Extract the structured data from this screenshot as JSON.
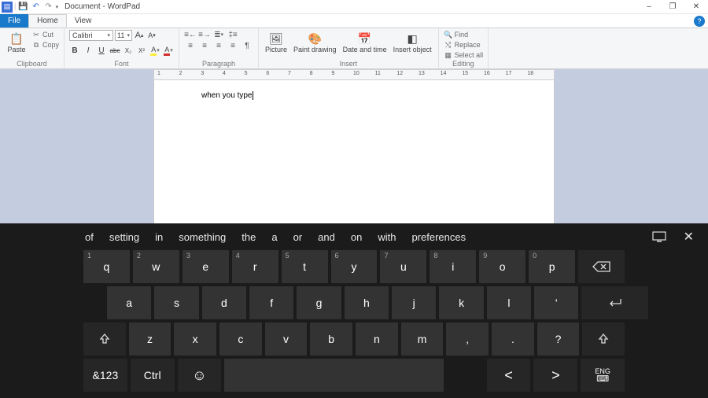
{
  "window": {
    "title": "Document - WordPad",
    "minimize": "–",
    "maximize": "❐",
    "close": "✕",
    "help": "?"
  },
  "qat": {
    "save": "💾",
    "undo": "↶",
    "redo": "↷"
  },
  "tabs": {
    "file": "File",
    "home": "Home",
    "view": "View"
  },
  "ribbon": {
    "clipboard": {
      "label": "Clipboard",
      "paste": "Paste",
      "cut": "Cut",
      "copy": "Copy"
    },
    "font": {
      "label": "Font",
      "name": "Calibri",
      "size": "11",
      "grow": "A",
      "shrink": "A",
      "bold": "B",
      "italic": "I",
      "underline": "U",
      "strike": "abc",
      "sub": "X₂",
      "sup": "X²",
      "highlight": "A",
      "color": "A"
    },
    "paragraph": {
      "label": "Paragraph"
    },
    "insert": {
      "label": "Insert",
      "picture": "Picture",
      "paint": "Paint drawing",
      "datetime": "Date and time",
      "object": "Insert object"
    },
    "editing": {
      "label": "Editing",
      "find": "Find",
      "replace": "Replace",
      "selectall": "Select all"
    }
  },
  "ruler": {
    "start": 1,
    "end": 18
  },
  "document": {
    "text": "when you type"
  },
  "osk": {
    "suggestions": [
      "of",
      "setting",
      "in",
      "something",
      "the",
      "a",
      "or",
      "and",
      "on",
      "with",
      "preferences"
    ],
    "row1": [
      {
        "k": "q",
        "h": "1"
      },
      {
        "k": "w",
        "h": "2"
      },
      {
        "k": "e",
        "h": "3"
      },
      {
        "k": "r",
        "h": "4"
      },
      {
        "k": "t",
        "h": "5"
      },
      {
        "k": "y",
        "h": "6"
      },
      {
        "k": "u",
        "h": "7"
      },
      {
        "k": "i",
        "h": "8"
      },
      {
        "k": "o",
        "h": "9"
      },
      {
        "k": "p",
        "h": "0"
      }
    ],
    "row2": [
      "a",
      "s",
      "d",
      "f",
      "g",
      "h",
      "j",
      "k",
      "l",
      "'"
    ],
    "row3": [
      "z",
      "x",
      "c",
      "v",
      "b",
      "n",
      "m",
      ",",
      ".",
      "?"
    ],
    "special": {
      "backspace": "⌫",
      "enter": "↵",
      "shift": "↑",
      "numsym": "&123",
      "ctrl": "Ctrl",
      "emoji": "☺",
      "left": "‹",
      "right": "›",
      "lang": "ENG"
    }
  }
}
